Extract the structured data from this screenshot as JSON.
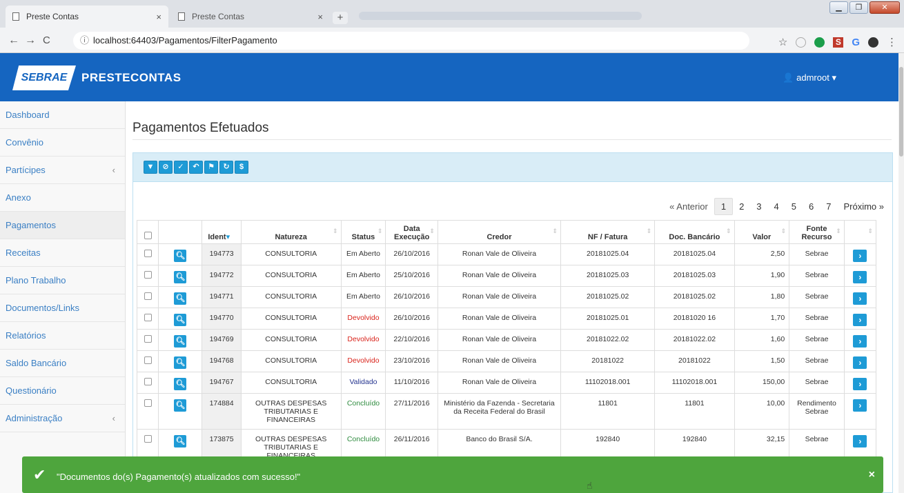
{
  "browser": {
    "tabs": [
      {
        "label": "Preste Contas",
        "close": "×"
      },
      {
        "label": "Preste Contas",
        "close": "×"
      }
    ],
    "new_tab": "+",
    "url_prefix": "ⓘ",
    "url": "localhost:64403/Pagamentos/FilterPagamento",
    "window_controls": [
      "▁",
      "❐",
      "✕"
    ]
  },
  "app": {
    "logo": "SEBRAE",
    "brand": "PRESTECONTAS",
    "user": "admroot"
  },
  "sidebar": {
    "items": [
      {
        "label": "Dashboard",
        "chevron": ""
      },
      {
        "label": "Convênio",
        "chevron": ""
      },
      {
        "label": "Partícipes",
        "chevron": "‹"
      },
      {
        "label": "Anexo",
        "chevron": ""
      },
      {
        "label": "Pagamentos",
        "chevron": ""
      },
      {
        "label": "Receitas",
        "chevron": ""
      },
      {
        "label": "Plano Trabalho",
        "chevron": ""
      },
      {
        "label": "Documentos/Links",
        "chevron": ""
      },
      {
        "label": "Relatórios",
        "chevron": ""
      },
      {
        "label": "Saldo Bancário",
        "chevron": ""
      },
      {
        "label": "Questionário",
        "chevron": ""
      },
      {
        "label": "Administração",
        "chevron": "‹"
      }
    ]
  },
  "page": {
    "title": "Pagamentos Efetuados"
  },
  "pager": {
    "prev": "« Anterior",
    "pages": [
      "1",
      "2",
      "3",
      "4",
      "5",
      "6",
      "7"
    ],
    "active": "1",
    "next": "Próximo »"
  },
  "table": {
    "headers": {
      "ident": "Ident",
      "natureza": "Natureza",
      "status": "Status",
      "data1": "Data",
      "data2": "Execução",
      "credor": "Credor",
      "nf": "NF / Fatura",
      "doc": "Doc. Bancário",
      "valor": "Valor",
      "fonte1": "Fonte",
      "fonte2": "Recurso"
    },
    "rows": [
      {
        "ident": "194773",
        "natureza": "CONSULTORIA",
        "status": "Em Aberto",
        "data": "26/10/2016",
        "credor": "Ronan Vale de Oliveira",
        "nf": "20181025.04",
        "doc": "20181025.04",
        "valor": "2,50",
        "fonte": "Sebrae"
      },
      {
        "ident": "194772",
        "natureza": "CONSULTORIA",
        "status": "Em Aberto",
        "data": "25/10/2016",
        "credor": "Ronan Vale de Oliveira",
        "nf": "20181025.03",
        "doc": "20181025.03",
        "valor": "1,90",
        "fonte": "Sebrae"
      },
      {
        "ident": "194771",
        "natureza": "CONSULTORIA",
        "status": "Em Aberto",
        "data": "26/10/2016",
        "credor": "Ronan Vale de Oliveira",
        "nf": "20181025.02",
        "doc": "20181025.02",
        "valor": "1,80",
        "fonte": "Sebrae"
      },
      {
        "ident": "194770",
        "natureza": "CONSULTORIA",
        "status": "Devolvido",
        "data": "26/10/2016",
        "credor": "Ronan Vale de Oliveira",
        "nf": "20181025.01",
        "doc": "20181020 16",
        "valor": "1,70",
        "fonte": "Sebrae"
      },
      {
        "ident": "194769",
        "natureza": "CONSULTORIA",
        "status": "Devolvido",
        "data": "22/10/2016",
        "credor": "Ronan Vale de Oliveira",
        "nf": "20181022.02",
        "doc": "20181022.02",
        "valor": "1,60",
        "fonte": "Sebrae"
      },
      {
        "ident": "194768",
        "natureza": "CONSULTORIA",
        "status": "Devolvido",
        "data": "23/10/2016",
        "credor": "Ronan Vale de Oliveira",
        "nf": "20181022",
        "doc": "20181022",
        "valor": "1,50",
        "fonte": "Sebrae"
      },
      {
        "ident": "194767",
        "natureza": "CONSULTORIA",
        "status": "Validado",
        "data": "11/10/2016",
        "credor": "Ronan Vale de Oliveira",
        "nf": "11102018.001",
        "doc": "11102018.001",
        "valor": "150,00",
        "fonte": "Sebrae"
      },
      {
        "ident": "174884",
        "natureza": "OUTRAS DESPESAS TRIBUTARIAS E FINANCEIRAS",
        "status": "Concluído",
        "data": "27/11/2016",
        "credor": "Ministério da Fazenda - Secretaria da Receita Federal do Brasil",
        "nf": "11801",
        "doc": "11801",
        "valor": "10,00",
        "fonte": "Rendimento Sebrae"
      },
      {
        "ident": "173875",
        "natureza": "OUTRAS DESPESAS TRIBUTARIAS E FINANCEIRAS",
        "status": "Concluído",
        "data": "26/11/2016",
        "credor": "Banco do Brasil S/A.",
        "nf": "192840",
        "doc": "192840",
        "valor": "32,15",
        "fonte": "Sebrae"
      }
    ]
  },
  "toast": {
    "message": "\"Documentos do(s) Pagamento(s) atualizados com sucesso!\"",
    "close": "×",
    "check": "✔"
  },
  "colors": {
    "primary": "#1565c0",
    "button": "#1e9bd6",
    "toast": "#4ea53d",
    "devolvido": "#d9221a",
    "concluido": "#2e8b3e",
    "validado": "#25348f"
  }
}
